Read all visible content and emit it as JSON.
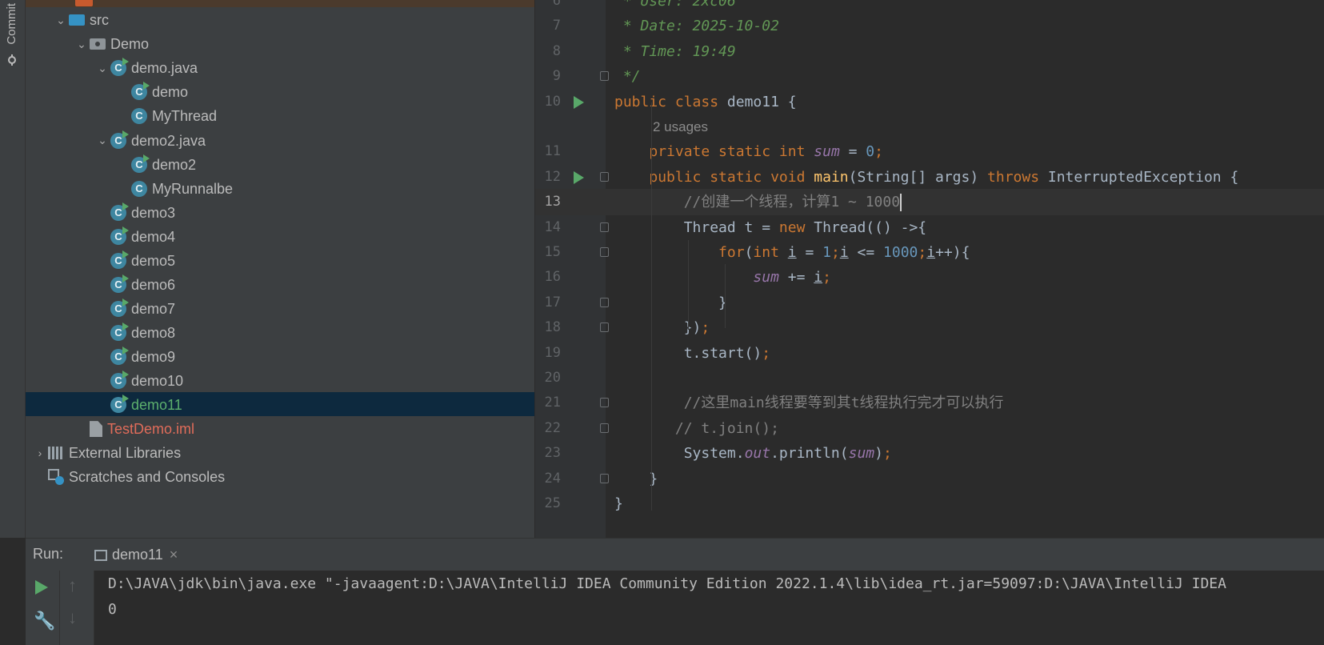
{
  "sidebar": {
    "commit_label": "Commit"
  },
  "project_tree": [
    {
      "label": "src",
      "type": "folder",
      "indent": 1,
      "expanded": true
    },
    {
      "label": "Demo",
      "type": "package",
      "indent": 2,
      "expanded": true
    },
    {
      "label": "demo.java",
      "type": "class-run",
      "indent": 3,
      "expanded": true
    },
    {
      "label": "demo",
      "type": "class-run",
      "indent": 4
    },
    {
      "label": "MyThread",
      "type": "class",
      "indent": 4
    },
    {
      "label": "demo2.java",
      "type": "class-run",
      "indent": 3,
      "expanded": true
    },
    {
      "label": "demo2",
      "type": "class-run",
      "indent": 4
    },
    {
      "label": "MyRunnalbe",
      "type": "class",
      "indent": 4
    },
    {
      "label": "demo3",
      "type": "class-run",
      "indent": 3
    },
    {
      "label": "demo4",
      "type": "class-run",
      "indent": 3
    },
    {
      "label": "demo5",
      "type": "class-run",
      "indent": 3
    },
    {
      "label": "demo6",
      "type": "class-run",
      "indent": 3
    },
    {
      "label": "demo7",
      "type": "class-run",
      "indent": 3
    },
    {
      "label": "demo8",
      "type": "class-run",
      "indent": 3
    },
    {
      "label": "demo9",
      "type": "class-run",
      "indent": 3
    },
    {
      "label": "demo10",
      "type": "class-run",
      "indent": 3
    },
    {
      "label": "demo11",
      "type": "class-run",
      "indent": 3,
      "selected": true
    },
    {
      "label": "TestDemo.iml",
      "type": "iml",
      "indent": 2
    },
    {
      "label": "External Libraries",
      "type": "libs",
      "indent": 0,
      "expanded": false
    },
    {
      "label": "Scratches and Consoles",
      "type": "scratch",
      "indent": 0
    }
  ],
  "editor": {
    "usages_hint": "2 usages",
    "lines": [
      {
        "n": "6",
        "html": "<span class='d'> * User: 2xc06</span>"
      },
      {
        "n": "7",
        "html": "<span class='d'> * Date: 2025-10-02</span>"
      },
      {
        "n": "8",
        "html": "<span class='d'> * Time: 19:49</span>"
      },
      {
        "n": "9",
        "html": "<span class='d'> */</span>",
        "fold": true
      },
      {
        "n": "10",
        "html": "<span class='k'>public class </span>demo11 {",
        "run": true
      },
      {
        "n": "",
        "hint": true
      },
      {
        "n": "11",
        "html": "    <span class='k'>private static int </span><span class='f'>sum</span> = <span class='n'>0</span><span class='k'>;</span>"
      },
      {
        "n": "12",
        "html": "    <span class='k'>public static void </span><span class='m'>main</span>(String[] args) <span class='k'>throws </span>InterruptedException {",
        "run": true,
        "fold": true
      },
      {
        "n": "13",
        "html": "        <span class='c'>//创建一个线程，计算1 ~ 1000</span><span class='caret'></span>",
        "current": true
      },
      {
        "n": "14",
        "html": "        Thread t = <span class='k'>new </span>Thread(() -&gt;{",
        "fold": true
      },
      {
        "n": "15",
        "html": "            <span class='k'>for</span>(<span class='k'>int </span><span class='u'>i</span> = <span class='n'>1</span><span class='k'>;</span><span class='u'>i</span> &lt;= <span class='n'>1000</span><span class='k'>;</span><span class='u'>i</span>++){",
        "fold": true
      },
      {
        "n": "16",
        "html": "                <span class='f'>sum</span> += <span class='u'>i</span><span class='k'>;</span>"
      },
      {
        "n": "17",
        "html": "            }",
        "fold": true
      },
      {
        "n": "18",
        "html": "        })<span class='k'>;</span>",
        "fold": true
      },
      {
        "n": "19",
        "html": "        t.start()<span class='k'>;</span>"
      },
      {
        "n": "20",
        "html": ""
      },
      {
        "n": "21",
        "html": "        <span class='c'>//这里main线程要等到其t线程执行完才可以执行</span>",
        "fold": true
      },
      {
        "n": "22",
        "html": "       <span class='c'>// t.join();</span>",
        "fold": true
      },
      {
        "n": "23",
        "html": "        System.<span class='f'>out</span>.println(<span class='f'>sum</span>)<span class='k'>;</span>"
      },
      {
        "n": "24",
        "html": "    }",
        "fold": true
      },
      {
        "n": "25",
        "html": "}"
      }
    ]
  },
  "run_panel": {
    "label": "Run:",
    "tab": "demo11",
    "close": "×",
    "output": [
      "D:\\JAVA\\jdk\\bin\\java.exe \"-javaagent:D:\\JAVA\\IntelliJ IDEA Community Edition 2022.1.4\\lib\\idea_rt.jar=59097:D:\\JAVA\\IntelliJ IDEA",
      "0"
    ]
  }
}
